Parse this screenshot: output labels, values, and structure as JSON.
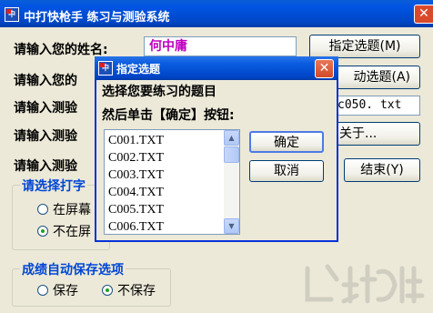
{
  "window": {
    "title": "中打快枪手  练习与测验系统",
    "close_glyph": "✕"
  },
  "form": {
    "name_label": "请输入您的姓名:",
    "name_value": "何中庸",
    "row2_label": "请输入您的",
    "row3_label": "请输入测验",
    "row4_label": "请输入测验",
    "row5_label": "请输入测验",
    "file_value": "c050. txt"
  },
  "buttons": {
    "select_topic": "指定选题(M)",
    "auto_topic": "动选题(A)",
    "about": "关于...",
    "finish": "结束(Y)"
  },
  "typing_group": {
    "title": "请选择打字",
    "option1": "在屏幕",
    "option2": "不在屏",
    "selected": "option2"
  },
  "save_group": {
    "title": "成绩自动保存选项",
    "option_save": "保存",
    "option_nosave": "不保存",
    "selected": "option_nosave"
  },
  "dialog": {
    "title": "指定选题",
    "close_glyph": "✕",
    "instruction_line1": "选择您要练习的题目",
    "instruction_line2": "然后单击【确定】按钮:",
    "ok_label": "确定",
    "cancel_label": "取消",
    "files": [
      "C001.TXT",
      "C002.TXT",
      "C003.TXT",
      "C004.TXT",
      "C005.TXT",
      "C006.TXT"
    ]
  },
  "colors": {
    "accent_blue": "#0054e3",
    "group_title": "#0046d5",
    "name_value": "#c000c0"
  }
}
